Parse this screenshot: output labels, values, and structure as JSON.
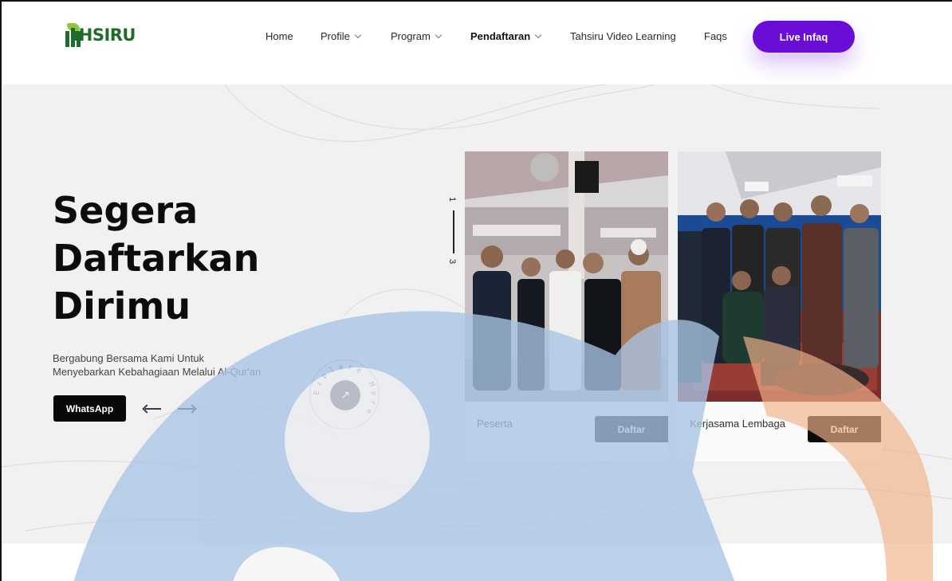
{
  "header": {
    "logo_text": "IHSIRU",
    "logo_letter": "T",
    "nav": [
      {
        "label": "Home",
        "dropdown": false,
        "active": false
      },
      {
        "label": "Profile",
        "dropdown": true,
        "active": false
      },
      {
        "label": "Program",
        "dropdown": true,
        "active": false
      },
      {
        "label": "Pendaftaran",
        "dropdown": true,
        "active": true
      },
      {
        "label": "Tahsiru Video Learning",
        "dropdown": false,
        "active": false
      },
      {
        "label": "Faqs",
        "dropdown": false,
        "active": false
      }
    ],
    "cta_label": "Live Infaq"
  },
  "hero": {
    "title_lines": [
      "Segera",
      "Daftarkan",
      "Dirimu"
    ],
    "subtitle_lines": [
      "Bergabung Bersama Kami Untuk",
      "Menyebarkan Kebahagiaan Melalui Al-Qur'an"
    ],
    "whatsapp_label": "WhatsApp",
    "explore_text": "Explore More",
    "pager": {
      "current": "1",
      "total": "3"
    },
    "cards": [
      {
        "label": "Peserta",
        "button": "Daftar"
      },
      {
        "label": "Kerjasama Lembaga",
        "button": "Daftar"
      }
    ]
  },
  "colors": {
    "accent": "#6a0dd6",
    "logo_green": "#1f6b2c",
    "logo_leaf": "#8cc63f",
    "hero_bg": "#f2f1f2",
    "watermark_blue": "#a9c4e4",
    "watermark_orange": "#f2b48a"
  }
}
